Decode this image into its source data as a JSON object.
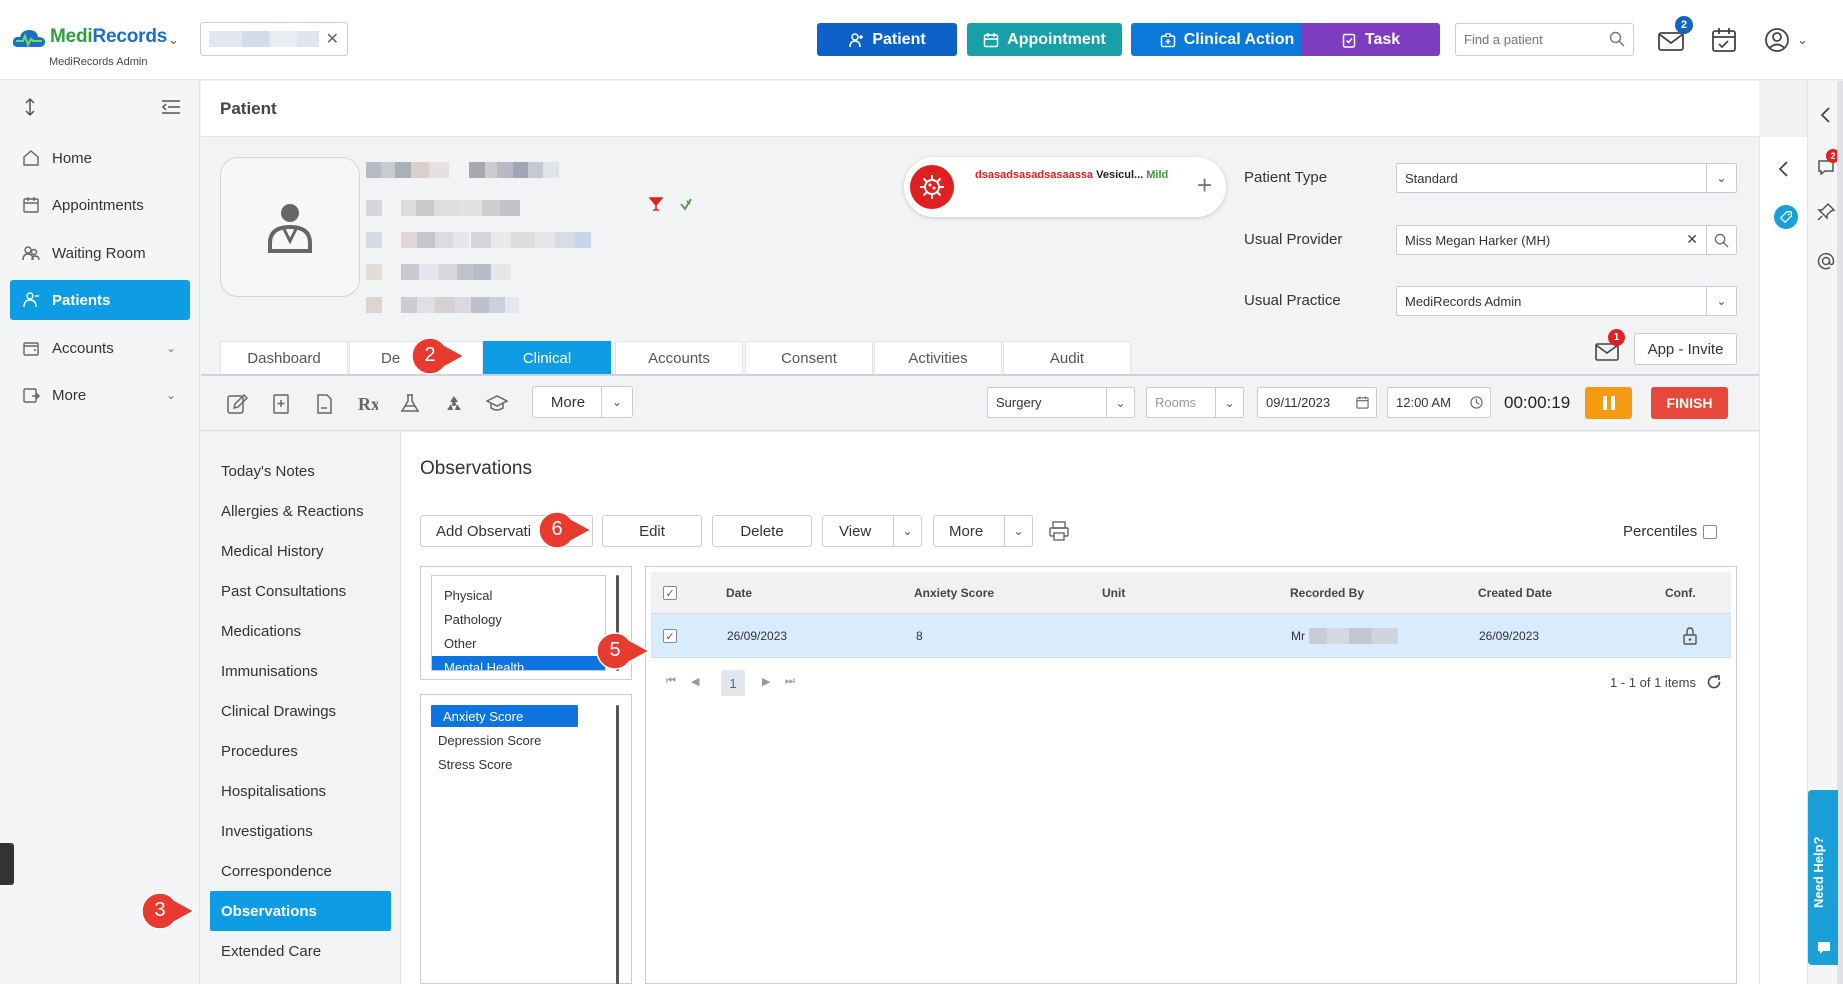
{
  "app": {
    "logo_part1": "Medi",
    "logo_part2": "Records",
    "logo_sub": "MediRecords Admin"
  },
  "topbar": {
    "buttons": {
      "patient": "Patient",
      "appointment": "Appointment",
      "clinical_action": "Clinical Action",
      "task": "Task"
    },
    "find_placeholder": "Find a patient",
    "mail_badge": "2",
    "colors": {
      "patient": "#0c62c9",
      "appointment": "#17a0a8",
      "clinical_action": "#0a79d9",
      "task": "#7e3dc1"
    }
  },
  "leftnav": {
    "items": [
      {
        "label": "Home",
        "icon": "home-icon"
      },
      {
        "label": "Appointments",
        "icon": "calendar-icon"
      },
      {
        "label": "Waiting Room",
        "icon": "people-icon"
      },
      {
        "label": "Patients",
        "icon": "patient-icon",
        "active": true
      },
      {
        "label": "Accounts",
        "icon": "wallet-icon"
      },
      {
        "label": "More",
        "icon": "more-icon"
      }
    ]
  },
  "page": {
    "title": "Patient"
  },
  "patient": {
    "alert": {
      "name": "dsasadsasadsasaassa",
      "reaction": "Vesicul...",
      "severity": "Mild"
    },
    "fields": {
      "patient_type_label": "Patient Type",
      "patient_type_value": "Standard",
      "usual_provider_label": "Usual Provider",
      "usual_provider_value": "Miss Megan Harker (MH)",
      "usual_practice_label": "Usual Practice",
      "usual_practice_value": "MediRecords Admin"
    },
    "tabs": [
      "Dashboard",
      "De",
      "Clinical",
      "Accounts",
      "Consent",
      "Activities",
      "Audit"
    ],
    "app_invite": "App - Invite",
    "message_badge": "1"
  },
  "toolbar": {
    "more": "More",
    "location": "Surgery",
    "rooms_placeholder": "Rooms",
    "date": "09/11/2023",
    "time": "12:00 AM",
    "timer": "00:00:19",
    "finish": "FINISH"
  },
  "clinical_nav": {
    "items": [
      "Today's Notes",
      "Allergies & Reactions",
      "Medical History",
      "Past Consultations",
      "Medications",
      "Immunisations",
      "Clinical Drawings",
      "Procedures",
      "Hospitalisations",
      "Investigations",
      "Correspondence",
      "Observations",
      "Extended Care"
    ],
    "active": "Observations"
  },
  "observations": {
    "title": "Observations",
    "actions": {
      "add": "Add Observati",
      "edit": "Edit",
      "delete": "Delete",
      "view": "View",
      "more": "More"
    },
    "percentiles_label": "Percentiles",
    "categories": [
      "Physical",
      "Pathology",
      "Other",
      "Mental Health"
    ],
    "types": [
      "Anxiety Score",
      "Depression Score",
      "Stress Score"
    ],
    "grid": {
      "columns": [
        "Date",
        "Anxiety Score",
        "Unit",
        "Recorded By",
        "Created Date",
        "Conf."
      ],
      "rows": [
        {
          "date": "26/09/2023",
          "score": "8",
          "unit": "",
          "recorded_by": "Mr",
          "created": "26/09/2023"
        }
      ]
    },
    "pager": {
      "page": "1",
      "info": "1 - 1 of 1 items"
    }
  },
  "help": {
    "label": "Need Help?"
  },
  "right_panel": {
    "badge": "2"
  },
  "steps": [
    "2",
    "3",
    "5",
    "6"
  ]
}
